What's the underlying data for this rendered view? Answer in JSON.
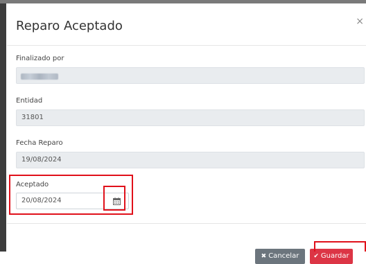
{
  "modal": {
    "title": "Reparo Aceptado",
    "close_glyph": "×",
    "fields": {
      "finalizado_por": {
        "label": "Finalizado por",
        "value": ""
      },
      "entidad": {
        "label": "Entidad",
        "value": "31801"
      },
      "fecha_reparo": {
        "label": "Fecha Reparo",
        "value": "19/08/2024"
      },
      "aceptado": {
        "label": "Aceptado",
        "value": "20/08/2024"
      }
    },
    "icons": {
      "calendar": "calendar-icon",
      "cancel": "times-icon",
      "save": "check-icon"
    },
    "buttons": {
      "cancel_icon": "✖",
      "cancel_label": "Cancelar",
      "save_icon": "✔",
      "save_label": "Guardar"
    }
  },
  "colors": {
    "highlight": "#e0101a",
    "save_button": "#dc3545",
    "cancel_button": "#6c757d",
    "readonly_field": "#e9ecef"
  }
}
